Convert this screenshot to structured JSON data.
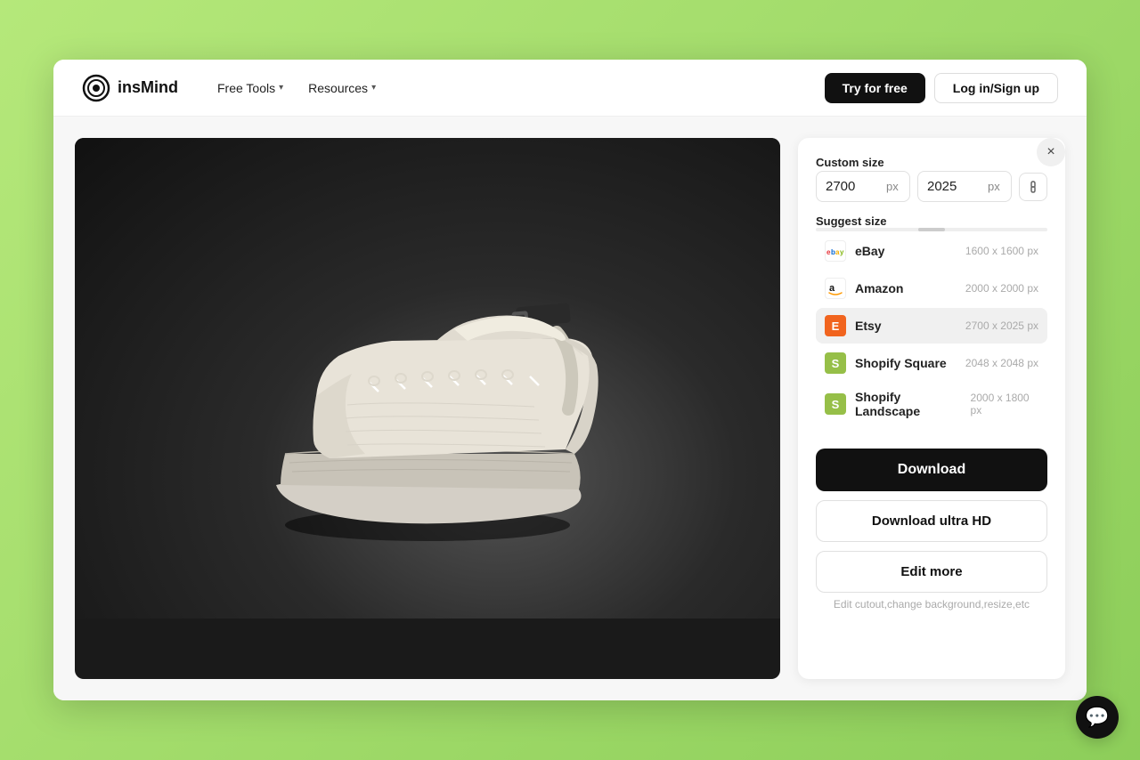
{
  "app": {
    "name": "insMind"
  },
  "navbar": {
    "logo_text": "insMind",
    "free_tools_label": "Free Tools",
    "resources_label": "Resources",
    "try_free_label": "Try for free",
    "login_label": "Log in/Sign up"
  },
  "panel": {
    "close_label": "×",
    "custom_size_label": "Custom size",
    "width_value": "2700",
    "height_value": "2025",
    "unit": "px",
    "suggest_size_label": "Suggest size",
    "platforms": [
      {
        "id": "ebay",
        "name": "eBay",
        "size": "1600 x 1600 px",
        "icon_type": "ebay"
      },
      {
        "id": "amazon",
        "name": "Amazon",
        "size": "2000 x 2000 px",
        "icon_type": "amazon"
      },
      {
        "id": "etsy",
        "name": "Etsy",
        "size": "2700 x 2025 px",
        "icon_type": "etsy",
        "active": true
      },
      {
        "id": "shopify-square",
        "name": "Shopify Square",
        "size": "2048 x 2048 px",
        "icon_type": "shopify"
      },
      {
        "id": "shopify-landscape",
        "name": "Shopify Landscape",
        "size": "2000 x 1800 px",
        "icon_type": "shopify"
      }
    ],
    "download_label": "Download",
    "download_hd_label": "Download ultra HD",
    "edit_more_label": "Edit more",
    "edit_hint": "Edit cutout,change background,resize,etc"
  },
  "chat": {
    "icon": "💬"
  }
}
